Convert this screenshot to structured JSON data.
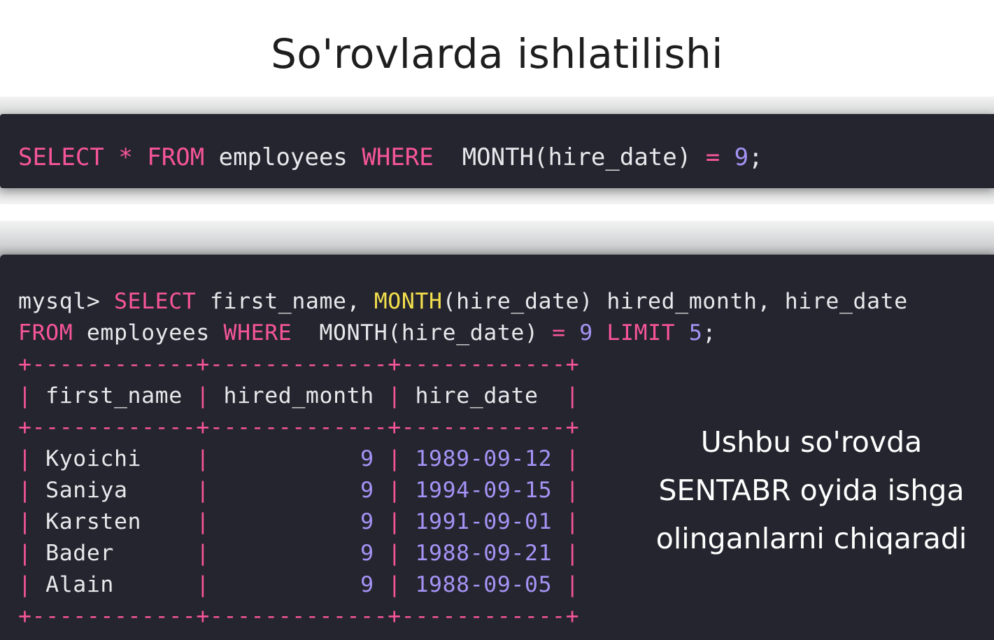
{
  "slide_title": "So'rovlarda ishlatilishi",
  "query_box": {
    "kw_select": "SELECT",
    "star": "*",
    "kw_from": "FROM",
    "table": "employees",
    "kw_where": "WHERE",
    "func_call": "MONTH(hire_date)",
    "eq": "=",
    "value": "9",
    "semicolon": ";"
  },
  "terminal": {
    "prompt": "mysql>",
    "line1": {
      "kw_select": "SELECT",
      "col1": "first_name,",
      "fn_month": "MONTH",
      "arg": "(hire_date)",
      "alias": "hired_month,",
      "col3": "hire_date"
    },
    "line2": {
      "kw_from": "FROM",
      "table": "employees",
      "kw_where": "WHERE",
      "func_call": "MONTH(hire_date)",
      "eq": "=",
      "value": "9",
      "kw_limit": "LIMIT",
      "limit": "5",
      "semicolon": ";"
    },
    "border": "+------------+-------------+------------+",
    "headers": [
      "first_name",
      "hired_month",
      "hire_date"
    ],
    "rows": [
      {
        "first_name": "Kyoichi",
        "hired_month": "9",
        "hire_date": "1989-09-12"
      },
      {
        "first_name": "Saniya",
        "hired_month": "9",
        "hire_date": "1994-09-15"
      },
      {
        "first_name": "Karsten",
        "hired_month": "9",
        "hire_date": "1991-09-01"
      },
      {
        "first_name": "Bader",
        "hired_month": "9",
        "hire_date": "1988-09-21"
      },
      {
        "first_name": "Alain",
        "hired_month": "9",
        "hire_date": "1988-09-05"
      }
    ]
  },
  "note": {
    "line1": "Ushbu so'rovda",
    "line2": "SENTABR oyida ishga",
    "line3": "olinganlarni chiqaradi"
  },
  "colors": {
    "keyword": "#f7559a",
    "function": "#f4e04d",
    "number": "#a593f5",
    "text": "#e8e8ec",
    "code_bg": "#25252f"
  }
}
